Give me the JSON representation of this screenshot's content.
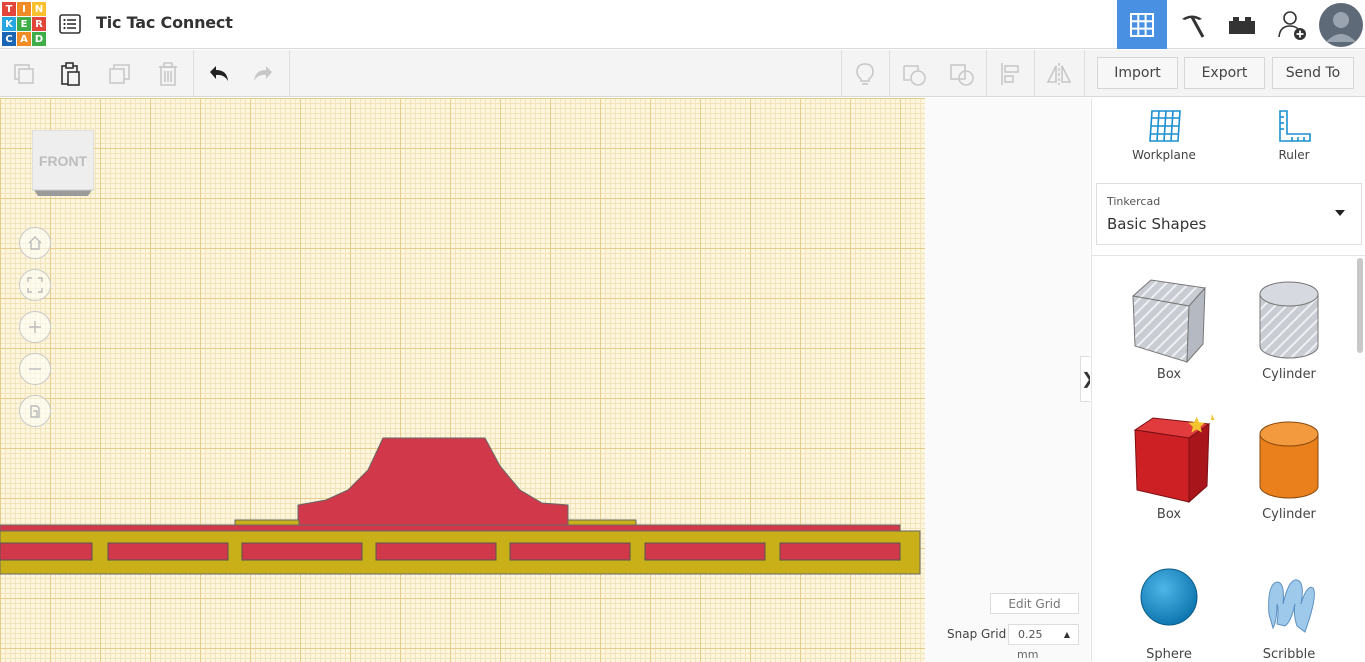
{
  "app": {
    "logo_letters": [
      "T",
      "I",
      "N",
      "K",
      "E",
      "R",
      "C",
      "A",
      "D"
    ],
    "logo_colors": [
      "#e2463b",
      "#f18b25",
      "#fbc02d",
      "#26a7e1",
      "#3fae49",
      "#e2463b",
      "#1a66b5",
      "#f18b25",
      "#3fae49"
    ],
    "title": "Tic Tac Connect"
  },
  "topbar": {
    "buttons": [
      {
        "icon": "3d-view-grid-icon",
        "active": true
      },
      {
        "icon": "pickaxe-icon",
        "active": false
      },
      {
        "icon": "bricks-icon",
        "active": false
      },
      {
        "icon": "add-user-icon",
        "active": false
      },
      {
        "icon": "avatar",
        "active": false
      }
    ],
    "accent_color": "#4a90e2"
  },
  "toolbar": {
    "import_label": "Import",
    "export_label": "Export",
    "sendto_label": "Send To"
  },
  "viewcube": {
    "face_label": "FRONT"
  },
  "canvas": {
    "edit_grid_label": "Edit Grid",
    "snap_grid_label": "Snap Grid",
    "snap_value": "0.25",
    "snap_unit": "mm",
    "collapse_glyph": "❯"
  },
  "panel": {
    "workplane_label": "Workplane",
    "ruler_label": "Ruler",
    "library_category": "Tinkercad",
    "library_name": "Basic Shapes",
    "shapes": [
      {
        "label": "Box",
        "kind": "hole-box"
      },
      {
        "label": "Cylinder",
        "kind": "hole-cylinder"
      },
      {
        "label": "Box",
        "kind": "box"
      },
      {
        "label": "Cylinder",
        "kind": "cylinder"
      },
      {
        "label": "Sphere",
        "kind": "sphere"
      },
      {
        "label": "Scribble",
        "kind": "scribble"
      }
    ]
  },
  "colors": {
    "grid_bg": "#fdf5dc",
    "model_red": "#d1394a",
    "model_yellow": "#c9b019",
    "box_red": "#cc2025",
    "cylinder_orange": "#e9801c",
    "sphere_blue": "#1b94d1"
  }
}
